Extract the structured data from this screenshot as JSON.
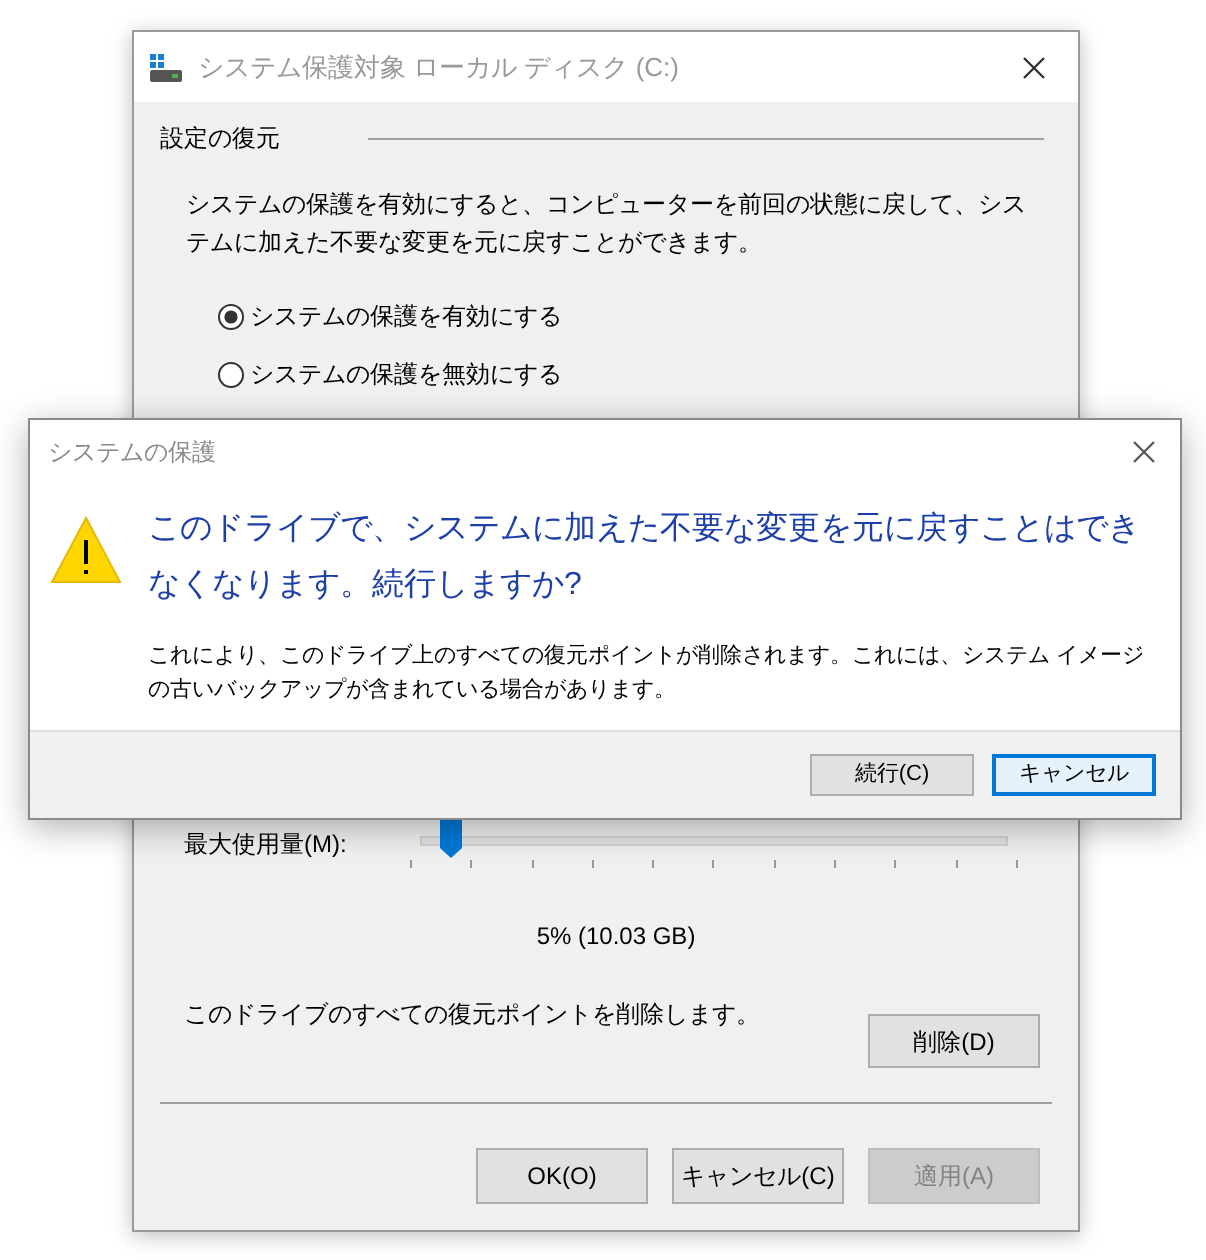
{
  "window": {
    "title": "システム保護対象 ローカル ディスク (C:)",
    "section": "設定の復元",
    "description": "システムの保護を有効にすると、コンピューターを前回の状態に戻して、システムに加えた不要な変更を元に戻すことができます。",
    "radios": [
      {
        "label": "システムの保護を有効にする",
        "selected": true
      },
      {
        "label": "システムの保護を無効にする",
        "selected": false
      }
    ],
    "slider": {
      "label": "最大使用量(M):",
      "level": 0.05,
      "reading": "5% (10.03 GB)"
    },
    "delete_text": "このドライブのすべての復元ポイントを削除します。",
    "delete_button": "削除(D)",
    "buttons": [
      {
        "label": "OK(O)",
        "disabled": false
      },
      {
        "label": "キャンセル(C)",
        "disabled": false
      },
      {
        "label": "適用(A)",
        "disabled": true
      }
    ]
  },
  "dialog": {
    "title": "システムの保護",
    "instruction": "このドライブで、システムに加えた不要な変更を元に戻すことはできなくなります。続行しますか?",
    "content": "これにより、このドライブ上のすべての復元ポイントが削除されます。これには、システム イメージの古いバックアップが含まれている場合があります。",
    "buttons": [
      {
        "label": "続行(C)",
        "default": false
      },
      {
        "label": "キャンセル",
        "default": true
      }
    ]
  }
}
